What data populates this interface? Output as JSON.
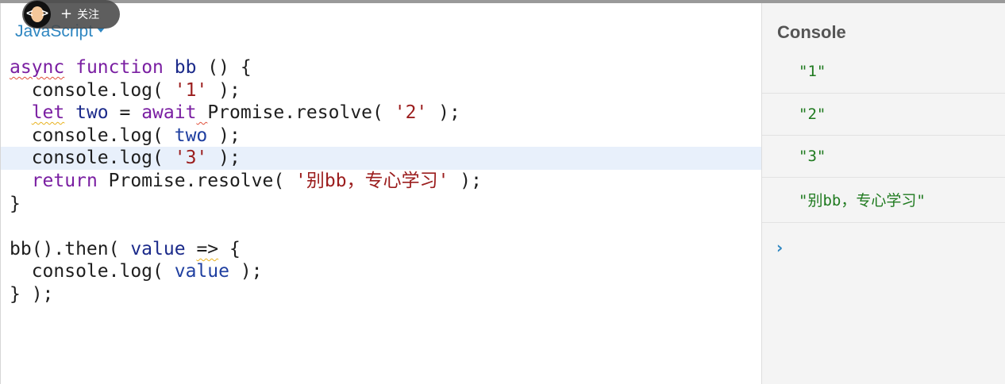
{
  "editor": {
    "language": "JavaScript",
    "lines": [
      [
        {
          "t": "async",
          "c": "kw squig"
        },
        {
          "t": " "
        },
        {
          "t": "function",
          "c": "kw"
        },
        {
          "t": " "
        },
        {
          "t": "bb",
          "c": "def"
        },
        {
          "t": " () {"
        }
      ],
      [
        {
          "t": "  console.log( "
        },
        {
          "t": "'1'",
          "c": "str"
        },
        {
          "t": " );"
        }
      ],
      [
        {
          "t": "  "
        },
        {
          "t": "let",
          "c": "kw squig-warn"
        },
        {
          "t": " "
        },
        {
          "t": "two",
          "c": "def"
        },
        {
          "t": " = "
        },
        {
          "t": "await",
          "c": "kw"
        },
        {
          "t": " ",
          "c": "squig"
        },
        {
          "t": "Promise.resolve( "
        },
        {
          "t": "'2'",
          "c": "str"
        },
        {
          "t": " );"
        }
      ],
      [
        {
          "t": "  console.log( "
        },
        {
          "t": "two",
          "c": "var"
        },
        {
          "t": " );"
        }
      ],
      [
        {
          "t": "  console.log( "
        },
        {
          "t": "'3'",
          "c": "str"
        },
        {
          "t": " );"
        }
      ],
      [
        {
          "t": "  "
        },
        {
          "t": "return",
          "c": "kw"
        },
        {
          "t": " Promise.resolve( "
        },
        {
          "t": "'别bb，专心学习'",
          "c": "str"
        },
        {
          "t": " );"
        }
      ],
      [
        {
          "t": "}"
        }
      ],
      [
        {
          "t": ""
        }
      ],
      [
        {
          "t": "bb().then( "
        },
        {
          "t": "value",
          "c": "def"
        },
        {
          "t": " "
        },
        {
          "t": "=>",
          "c": "squig-warn"
        },
        {
          "t": " {"
        }
      ],
      [
        {
          "t": "  console.log( "
        },
        {
          "t": "value",
          "c": "var"
        },
        {
          "t": " );"
        }
      ],
      [
        {
          "t": "} );"
        }
      ]
    ],
    "active_line": 4
  },
  "badge": {
    "label": "关注",
    "plus": "+",
    "bracket_left": "<",
    "bracket_right": ">"
  },
  "console": {
    "title": "Console",
    "entries": [
      "\"1\"",
      "\"2\"",
      "\"3\"",
      "\"别bb，专心学习\""
    ],
    "prompt": "›"
  },
  "colors": {
    "keyword": "#7a1fa2",
    "definition": "#1b2a8a",
    "string": "#9b1d1d",
    "variable": "#1f3fa0",
    "console_output": "#1f7a1f",
    "accent": "#2e86c1",
    "active_line": "#e8f0fb"
  }
}
